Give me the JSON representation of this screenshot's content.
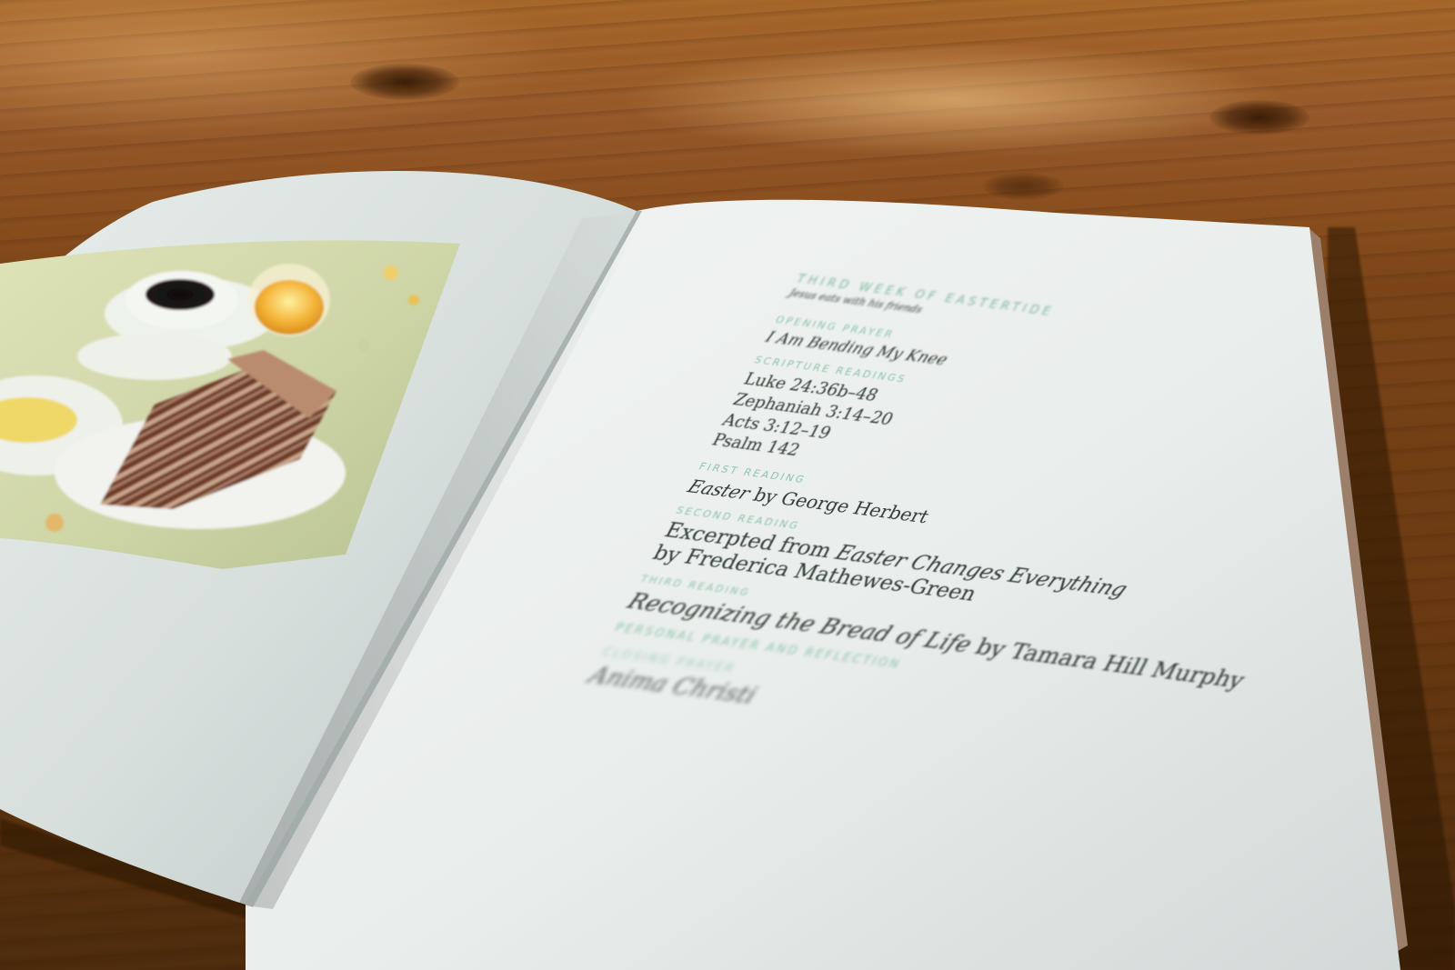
{
  "book": {
    "week_title": "Third Week of Eastertide",
    "week_subtitle": "Jesus eats with his friends",
    "sections": {
      "opening_prayer": {
        "label": "Opening Prayer",
        "value": "I Am Bending My Knee"
      },
      "scripture_readings": {
        "label": "Scripture Readings",
        "items": [
          "Luke 24:36b–48",
          "Zephaniah 3:14–20",
          "Acts 3:12–19",
          "Psalm 142"
        ]
      },
      "first_reading": {
        "label": "First Reading",
        "title": "Easter",
        "byline": " by George Herbert"
      },
      "second_reading": {
        "label": "Second Reading",
        "prefix": "Excerpted from ",
        "title": "Easter Changes Everything",
        "byline": "by Frederica Mathewes-Green"
      },
      "third_reading": {
        "label": "Third Reading",
        "title": "Recognizing the Bread of Life",
        "byline": " by Tamara Hill Murphy"
      },
      "personal_prayer": {
        "label": "Personal Prayer and Reflection"
      },
      "closing_prayer": {
        "label": "Closing Prayer",
        "value": "Anima Christi"
      }
    }
  },
  "photo": {
    "subject": "breakfast-table-photo"
  },
  "colors": {
    "accent_teal": "#8ec3ae",
    "paper": "#eef1ee",
    "wood": "#8a4f1e"
  }
}
